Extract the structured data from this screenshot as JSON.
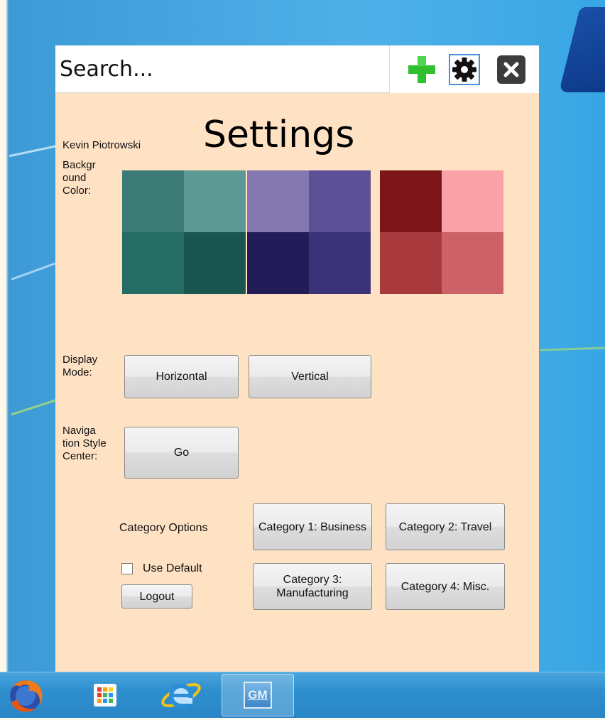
{
  "search": {
    "placeholder": "Search..."
  },
  "toolbar": {
    "add_icon": "plus-icon",
    "settings_icon": "gear-icon",
    "close_icon": "close-icon",
    "add_color": "#2fbf2f"
  },
  "header": {
    "user_name": "Kevin Piotrowski",
    "title": "Settings"
  },
  "background_color": {
    "label": "Backgr ound Color:",
    "swatches": [
      {
        "name": "teal",
        "colors": [
          "#3c7b76",
          "#5e9893",
          "#256c64",
          "#1a5550"
        ]
      },
      {
        "name": "purple",
        "colors": [
          "#8577b0",
          "#5c5096",
          "#231c58",
          "#3c3278"
        ]
      },
      {
        "name": "red",
        "colors": [
          "#7c1619",
          "#f8a2a7",
          "#a83a3e",
          "#cc6268"
        ]
      }
    ]
  },
  "display_mode": {
    "label": "Display Mode:",
    "horizontal": "Horizontal",
    "vertical": "Vertical"
  },
  "navigation": {
    "label": "Naviga tion Style Center:",
    "go": "Go"
  },
  "categories": {
    "label": "Category Options",
    "cat1": "Category 1: Business",
    "cat2": "Category 2: Travel",
    "cat3": "Category 3: Manufacturing",
    "cat4": "Category 4: Misc."
  },
  "options": {
    "use_default": "Use Default",
    "use_default_checked": false,
    "logout": "Logout"
  },
  "taskbar": {
    "items": [
      "firefox-icon",
      "apps-icon",
      "internet-explorer-icon",
      "gm-icon"
    ],
    "gm_label": "GM"
  }
}
